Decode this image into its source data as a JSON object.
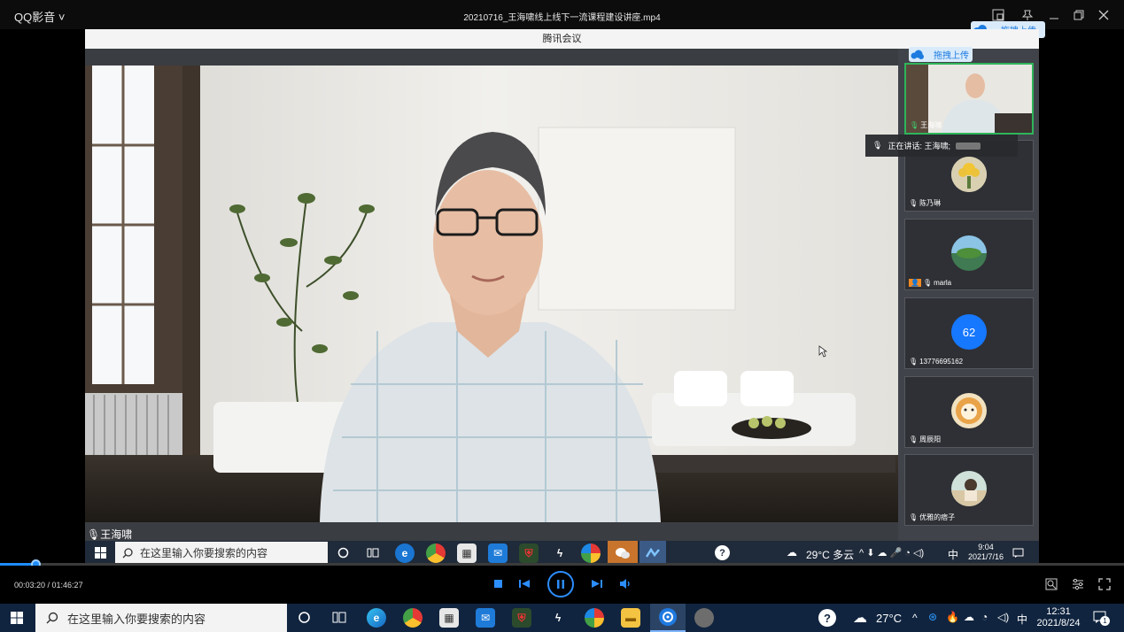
{
  "player": {
    "app_name": "QQ影音",
    "file_title": "20210716_王海啸线上线下一流课程建设讲座.mp4",
    "time_display": "00:03:20 / 01:46:27",
    "progress": 0.0313
  },
  "meeting": {
    "title": "腾讯会议",
    "upload_label": "拖拽上传",
    "speaker_label": "王海啸",
    "speaking_tip": "正在讲话: 王海啸;",
    "participants": [
      {
        "name": "王海啸",
        "avatar": "video"
      },
      {
        "name": "陈乃琳",
        "avatar": "flowers"
      },
      {
        "name": "marla",
        "avatar": "island"
      },
      {
        "name": "13776695162",
        "avatar": "62"
      },
      {
        "name": "周辰阳",
        "avatar": "lion"
      },
      {
        "name": "优雅的痞子",
        "avatar": "beach"
      }
    ]
  },
  "inner_taskbar": {
    "search_placeholder": "在这里输入你要搜索的内容",
    "weather": "29°C 多云",
    "ime": "中",
    "time": "9:04",
    "date": "2021/7/16"
  },
  "taskbar": {
    "search_placeholder": "在这里输入你要搜索的内容",
    "weather": "27°C",
    "ime": "中",
    "time": "12:31",
    "date": "2021/8/24",
    "notification_count": "1"
  },
  "colors": {
    "accent": "#1e8cff",
    "taskbar": "#10243f"
  }
}
